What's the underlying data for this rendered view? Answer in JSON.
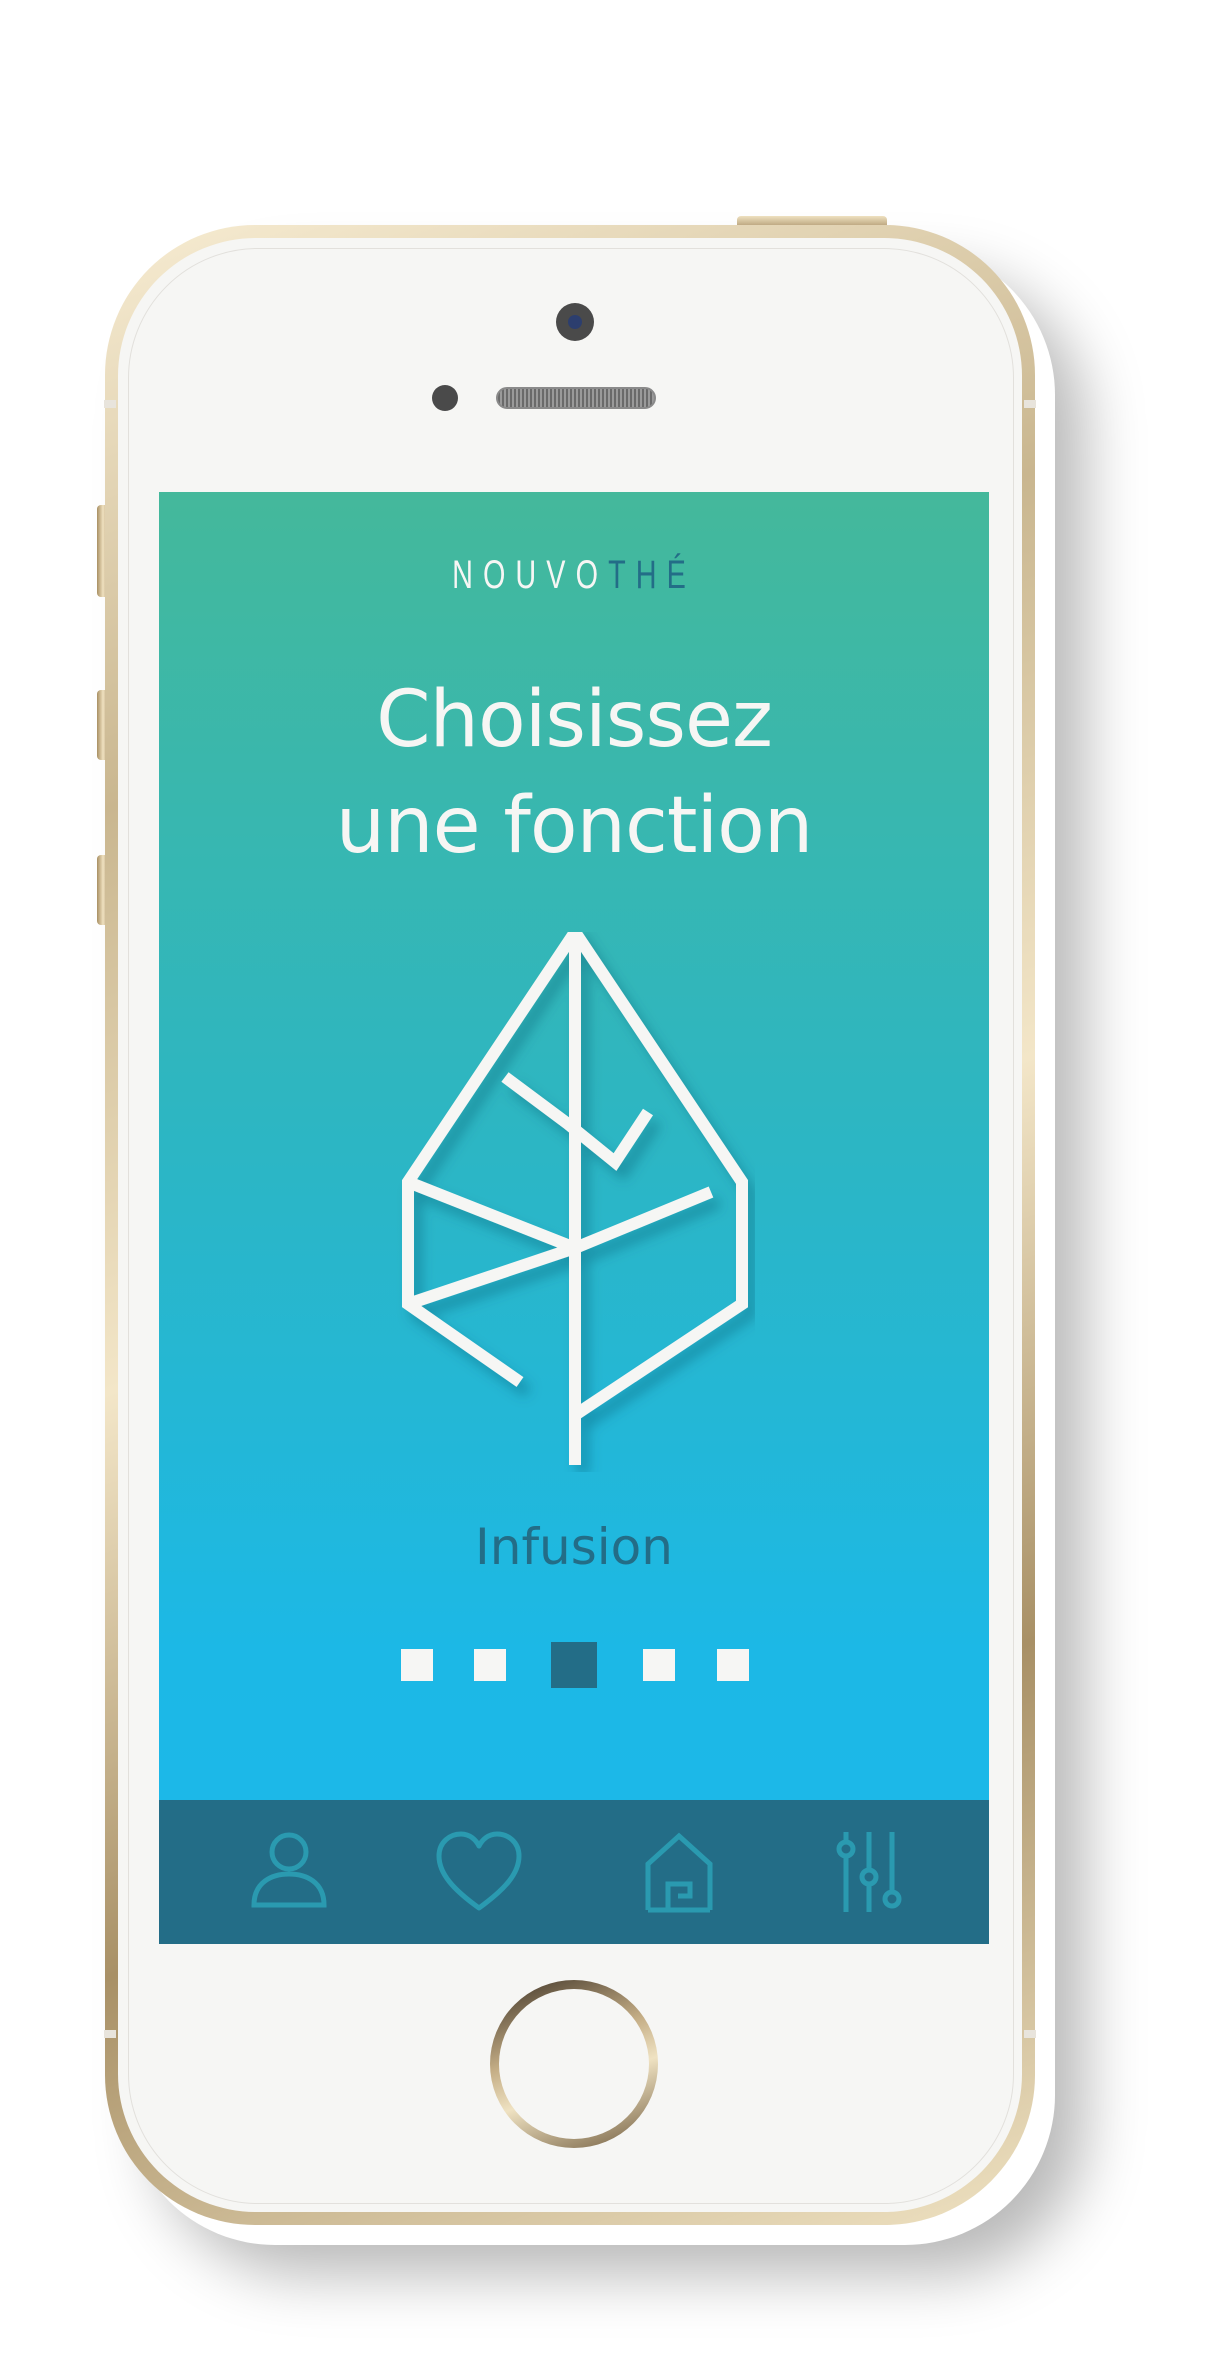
{
  "app": {
    "brand_part1": "NOUVO",
    "brand_part2": "THÉ"
  },
  "main": {
    "title_line1": "Choisissez",
    "title_line2": "une fonction",
    "function_icon": "leaf-icon",
    "function_label": "Infusion"
  },
  "pager": {
    "count": 5,
    "active_index": 2
  },
  "tabbar": {
    "items": [
      {
        "icon": "user-icon"
      },
      {
        "icon": "heart-icon"
      },
      {
        "icon": "home-icon"
      },
      {
        "icon": "sliders-icon"
      }
    ]
  },
  "colors": {
    "gradient_top": "#44b89b",
    "gradient_bottom": "#1cb8ea",
    "accent_dark": "#236d87",
    "foreground": "#f6f6f4",
    "tab_icon": "#2a9ab0"
  }
}
